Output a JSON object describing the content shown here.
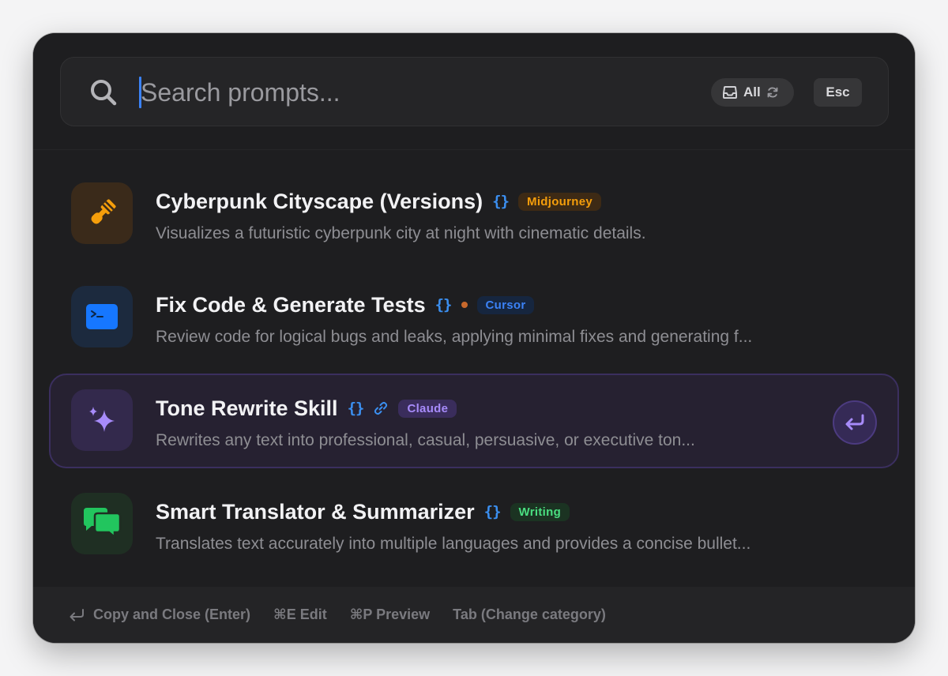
{
  "search": {
    "placeholder": "Search prompts...",
    "filter_label": "All",
    "esc_label": "Esc"
  },
  "items": [
    {
      "title": "Cyberpunk Cityscape (Versions)",
      "braces": "{}",
      "tag": "Midjourney",
      "tag_color": "#f59e0b",
      "tag_bg": "#3d2a15",
      "icon": "paintbrush-icon",
      "icon_bg": "#3a2a1a",
      "description": "Visualizes a futuristic cyberpunk city at night with cinematic details."
    },
    {
      "title": "Fix Code & Generate Tests",
      "braces": "{}",
      "tag": "Cursor",
      "tag_color": "#3b82f6",
      "tag_bg": "#16263f",
      "icon": "terminal-icon",
      "icon_bg": "#1c2a3e",
      "description": "Review code for logical bugs and leaks, applying minimal fixes and generating f..."
    },
    {
      "title": "Tone Rewrite Skill",
      "braces": "{}",
      "tag": "Claude",
      "tag_color": "#a78bfa",
      "tag_bg": "#3a2d5c",
      "icon": "sparkles-icon",
      "icon_bg": "#33294c",
      "description": "Rewrites any text into professional, casual, persuasive, or executive ton..."
    },
    {
      "title": "Smart Translator & Summarizer",
      "braces": "{}",
      "tag": "Writing",
      "tag_color": "#4ade80",
      "tag_bg": "#1b3322",
      "icon": "chat-bubbles-icon",
      "icon_bg": "#1f2f23",
      "description": "Translates text accurately into multiple languages and provides a concise bullet..."
    }
  ],
  "footer": {
    "copy_close": "Copy and Close (Enter)",
    "edit": "⌘E Edit",
    "preview": "⌘P Preview",
    "tab": "Tab (Change category)"
  },
  "colors": {
    "accent": "#3b82f6",
    "selected_accent": "#a78bfa",
    "background": "#1e1e20"
  }
}
